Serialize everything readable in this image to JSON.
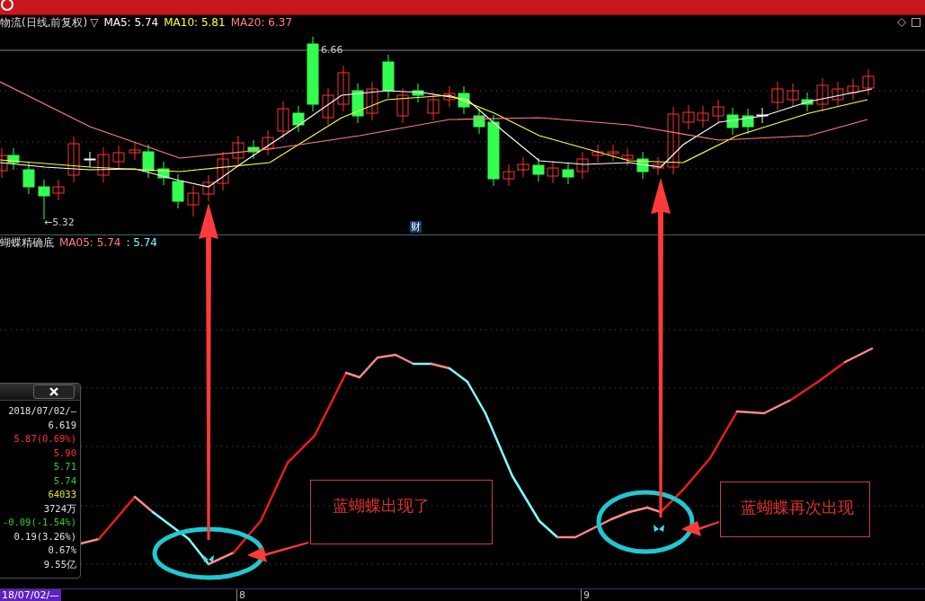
{
  "header": {
    "title": "物流(日线,前复权)",
    "marker": "▽",
    "ma": [
      {
        "label": "MA5: 5.74",
        "color": "#ffffff"
      },
      {
        "label": "MA10: 5.81",
        "color": "#ffff40"
      },
      {
        "label": "MA20: 6.37",
        "color": "#ff8080"
      }
    ]
  },
  "price_chart": {
    "high_label": "6.66",
    "low_label": "←5.32",
    "badge": "财"
  },
  "indicator": {
    "title": "蝴蝶精确底",
    "values": [
      {
        "label": "MA05: 5.74",
        "color": "#ff8080"
      },
      {
        "label": ": 5.74",
        "color": "#80ffff"
      }
    ]
  },
  "info_panel": {
    "rows": [
      {
        "text": "2018/07/02/—",
        "color": "#e0e0e0"
      },
      {
        "text": "6.619",
        "color": "#e0e0e0"
      },
      {
        "text": "5.87(0.69%)",
        "color": "#ff3030"
      },
      {
        "text": "5.90",
        "color": "#ff3030"
      },
      {
        "text": "5.71",
        "color": "#30d030"
      },
      {
        "text": "5.74",
        "color": "#30d030"
      },
      {
        "text": "64033",
        "color": "#e0e040"
      },
      {
        "text": "3724万",
        "color": "#e0e0e0"
      },
      {
        "text": "-0.09(-1.54%)",
        "color": "#30d030"
      },
      {
        "text": "0.19(3.26%)",
        "color": "#e0e0e0"
      },
      {
        "text": "0.67%",
        "color": "#e0e0e0"
      },
      {
        "text": "9.55亿",
        "color": "#e0e0e0"
      }
    ]
  },
  "annotations": [
    {
      "text": "蓝蝴蝶出现了"
    },
    {
      "text": "蓝蝴蝶再次出现"
    }
  ],
  "time_axis": {
    "cursor_label": "18/07/02/—",
    "ticks": [
      "8",
      "9"
    ]
  }
}
